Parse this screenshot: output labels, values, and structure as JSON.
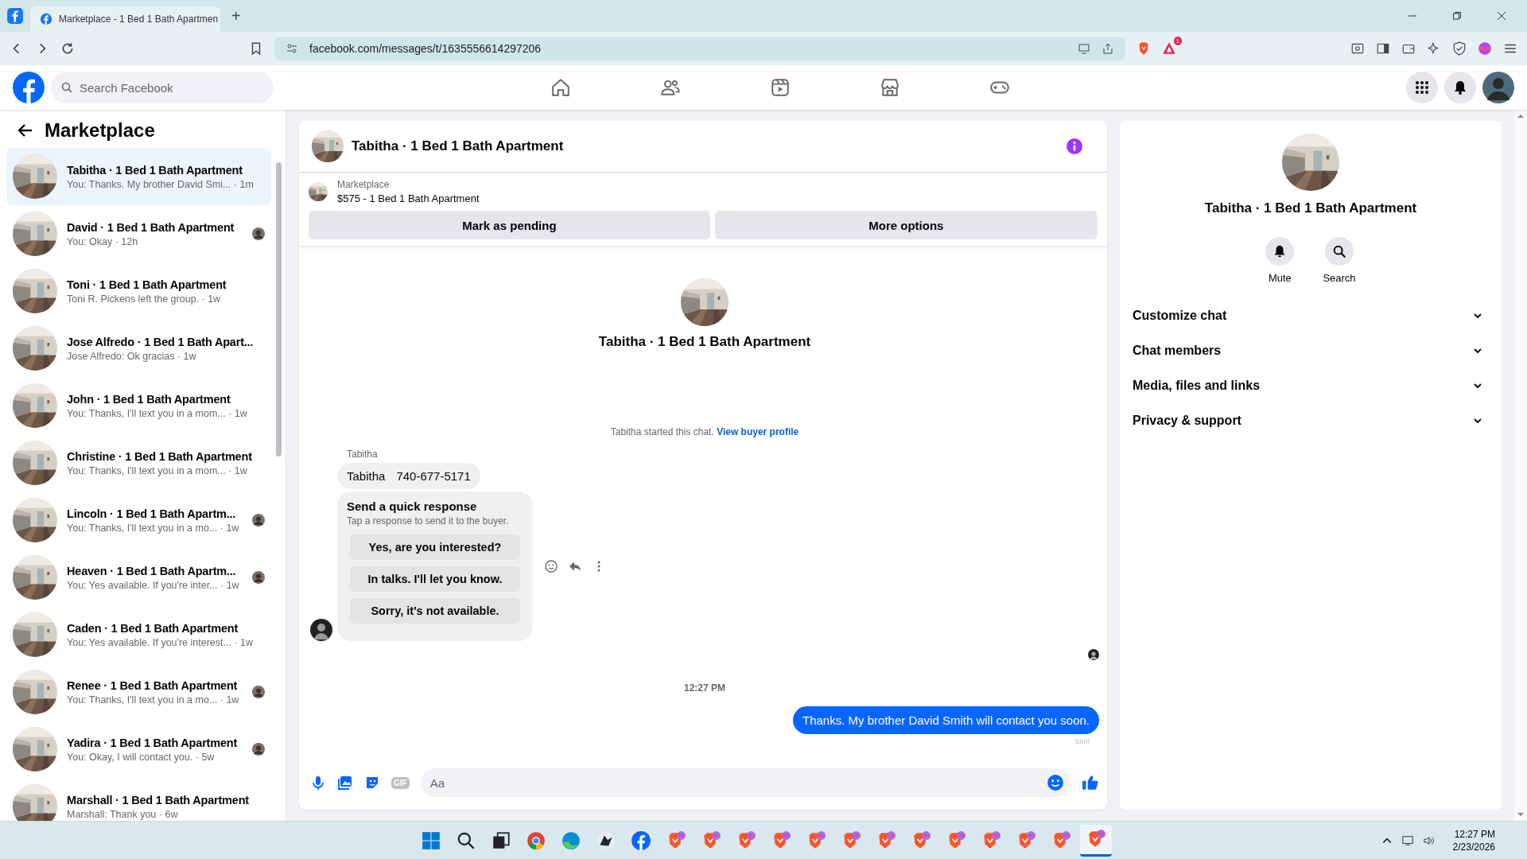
{
  "browser": {
    "tabs": [
      {
        "title": "Marketplace - 1 Bed 1 Bath Apartmen",
        "selected": true
      }
    ],
    "new_tab": "+",
    "url": "facebook.com/messages/t/1635556614297206",
    "rewards_badge": "1"
  },
  "header": {
    "search": {
      "placeholder": "Search Facebook"
    },
    "nav": [
      {
        "kind": "home"
      },
      {
        "kind": "friends"
      },
      {
        "kind": "video"
      },
      {
        "kind": "marketplace"
      },
      {
        "kind": "gaming"
      }
    ]
  },
  "sidebar": {
    "title": "Marketplace",
    "conversations": [
      {
        "name": "Tabitha · 1 Bed 1 Bath Apartment",
        "preview": "You: Thanks. My brother David Smi...",
        "time": "· 1m",
        "selected": true,
        "read_receipt": false
      },
      {
        "name": "David · 1 Bed 1 Bath Apartment",
        "preview": "You: Okay",
        "time": "· 12h",
        "selected": false,
        "read_receipt": true
      },
      {
        "name": "Toni · 1 Bed 1 Bath Apartment",
        "preview": "Toni R. Pickens left the group.",
        "time": "· 1w",
        "selected": false,
        "read_receipt": false
      },
      {
        "name": "Jose Alfredo · 1 Bed 1 Bath Apart...",
        "preview": "Jose Alfredo: Ok gracias",
        "time": "· 1w",
        "selected": false,
        "read_receipt": false
      },
      {
        "name": "John · 1 Bed 1 Bath Apartment",
        "preview": "You: Thanks, I'll text you in a mom...",
        "time": "· 1w",
        "selected": false,
        "read_receipt": false
      },
      {
        "name": "Christine · 1 Bed 1 Bath Apartment",
        "preview": "You: Thanks, I'll text you in a mom...",
        "time": "· 1w",
        "selected": false,
        "read_receipt": false
      },
      {
        "name": "Lincoln · 1 Bed 1 Bath Apartm...",
        "preview": "You: Thanks, I'll text you in a mo...",
        "time": "· 1w",
        "selected": false,
        "read_receipt": true
      },
      {
        "name": "Heaven · 1 Bed 1 Bath Apartm...",
        "preview": "You: Yes available. If you're inter...",
        "time": "· 1w",
        "selected": false,
        "read_receipt": true
      },
      {
        "name": "Caden · 1 Bed 1 Bath Apartment",
        "preview": "You: Yes available. If you're interest...",
        "time": "· 1w",
        "selected": false,
        "read_receipt": false
      },
      {
        "name": "Renee · 1 Bed 1 Bath Apartment",
        "preview": "You: Thanks, I'll text you in a mo...",
        "time": "· 1w",
        "selected": false,
        "read_receipt": true
      },
      {
        "name": "Yadira · 1 Bed 1 Bath Apartment",
        "preview": "You: Okay, I will contact you.",
        "time": "· 5w",
        "selected": false,
        "read_receipt": true
      },
      {
        "name": "Marshall · 1 Bed 1 Bath Apartment",
        "preview": "Marshall: Thank you",
        "time": "· 6w",
        "selected": false,
        "read_receipt": false
      }
    ]
  },
  "chat": {
    "title": "Tabitha · 1 Bed 1 Bath Apartment",
    "listing": {
      "source": "Marketplace",
      "title": "$575 - 1 Bed 1 Bath Apartment"
    },
    "actions": [
      "Mark as pending",
      "More options"
    ],
    "intro_title": "Tabitha · 1 Bed 1 Bath Apartment",
    "started": "Tabitha started this chat.",
    "buyer_link": "View buyer profile",
    "sender": "Tabitha",
    "contact": {
      "name": "Tabitha",
      "phone": "740-677-5171"
    },
    "quick": {
      "title": "Send a quick response",
      "subtitle": "Tap a response to send it to the buyer.",
      "options": [
        "Yes, are you interested?",
        "In talks. I'll let you know.",
        "Sorry, it's not available."
      ]
    },
    "timestamp": "12:27 PM",
    "sent_message": "Thanks. My brother David Smith will contact you soon.",
    "status": "Sent",
    "composer": {
      "gif": "GIF",
      "placeholder": "Aa"
    }
  },
  "details": {
    "title": "Tabitha · 1 Bed 1 Bath Apartment",
    "actions": [
      {
        "kind": "mute",
        "label": "Mute"
      },
      {
        "kind": "search",
        "label": "Search"
      }
    ],
    "sections": [
      {
        "label": "Customize chat",
        "expanded": false
      },
      {
        "label": "Chat members",
        "expanded": false
      },
      {
        "label": "Media, files and links",
        "expanded": false
      },
      {
        "label": "Privacy & support",
        "expanded": false
      }
    ]
  },
  "taskbar": {
    "apps": [
      {
        "kind": "start",
        "active": false
      },
      {
        "kind": "search",
        "active": false
      },
      {
        "kind": "taskview",
        "active": false
      },
      {
        "kind": "chrome",
        "active": false
      },
      {
        "kind": "edge",
        "active": false
      },
      {
        "kind": "game",
        "active": false
      },
      {
        "kind": "facebook",
        "active": false
      },
      {
        "kind": "brave",
        "active": false
      },
      {
        "kind": "brave",
        "active": false
      },
      {
        "kind": "brave",
        "active": false
      },
      {
        "kind": "brave",
        "active": false
      },
      {
        "kind": "brave",
        "active": false
      },
      {
        "kind": "brave",
        "active": false
      },
      {
        "kind": "brave",
        "active": false
      },
      {
        "kind": "brave",
        "active": false
      },
      {
        "kind": "brave",
        "active": false
      },
      {
        "kind": "brave",
        "active": false
      },
      {
        "kind": "brave",
        "active": false
      },
      {
        "kind": "brave",
        "active": false
      },
      {
        "kind": "brave",
        "active": true
      }
    ],
    "time": "12:27 PM",
    "date": "2/23/2026"
  }
}
